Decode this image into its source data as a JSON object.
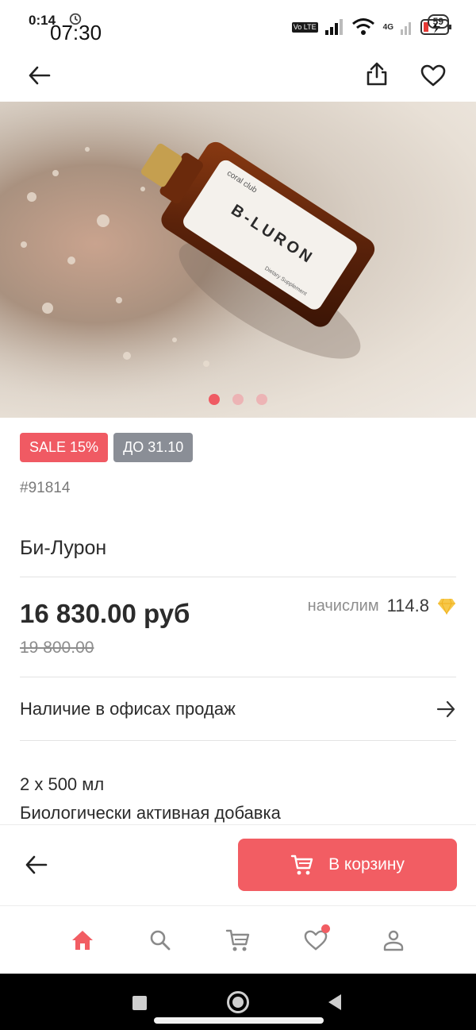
{
  "status_bar": {
    "time_small": "0:14",
    "time_overlay": "07:30",
    "network": "4G",
    "volte": "Vo LTE",
    "battery": "59"
  },
  "product": {
    "badges": {
      "sale": "SALE 15%",
      "until": "ДО 31.10"
    },
    "sku": "#91814",
    "title": "Би-Лурон",
    "price": "16 830.00 руб",
    "old_price": "19 800.00",
    "bonus": {
      "label": "начислим",
      "value": "114.8"
    },
    "offices_label": "Наличие в офисах продаж",
    "description": [
      "2 x 500 мл",
      "Биологически активная добавка"
    ],
    "image": {
      "brand_text": "coral club",
      "name_text": "B-LURON",
      "sub_text": "Dietary Supplement",
      "carousel_count": 3,
      "carousel_active": 1
    }
  },
  "actions": {
    "add_to_cart": "В корзину"
  },
  "colors": {
    "accent": "#f25d63",
    "sale_badge": "#f05a63",
    "date_badge": "#8a8e96",
    "bonus_gem": "#f7c84a"
  },
  "bottom_nav": [
    "home-icon",
    "search-icon",
    "cart-icon",
    "heart-icon",
    "profile-icon"
  ]
}
